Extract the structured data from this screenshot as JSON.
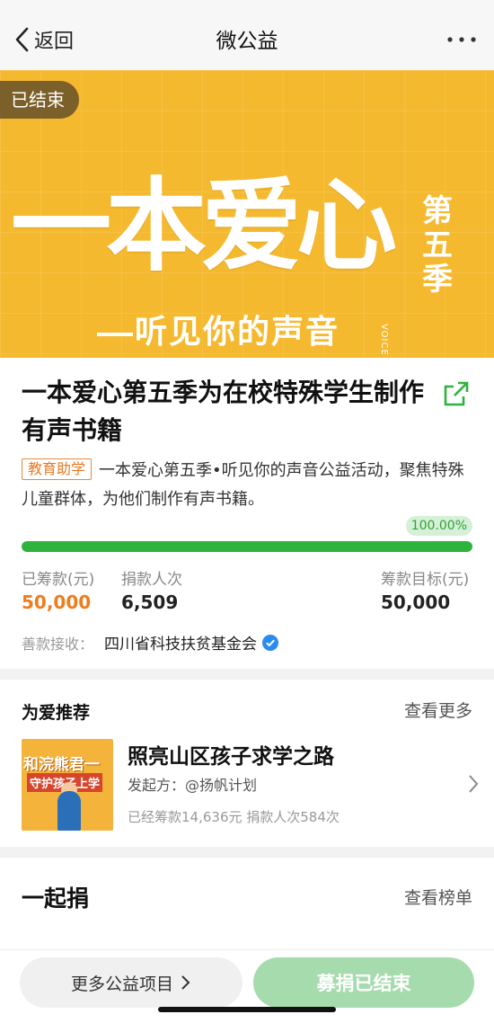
{
  "nav": {
    "back_label": "返回",
    "title": "微公益"
  },
  "banner": {
    "status": "已结束",
    "big_text": "一本爱心",
    "season": "第五季",
    "slogan": "听见你的声音",
    "voice": "VOICE"
  },
  "project": {
    "title": "一本爱心第五季为在校特殊学生制作有声书籍",
    "tag": "教育助学",
    "description": "一本爱心第五季•听见你的声音公益活动，聚焦特殊儿童群体，为他们制作有声书籍。",
    "progress_label": "100.00%",
    "progress": 1.0,
    "raised_label": "已筹款(元)",
    "raised_value": "50,000",
    "donors_label": "捐款人次",
    "donors_value": "6,509",
    "goal_label": "筹款目标(元)",
    "goal_value": "50,000",
    "receiver_label": "善款接收：",
    "receiver": "四川省科技扶贫基金会"
  },
  "recommend": {
    "heading": "为爱推荐",
    "more": "查看更多",
    "item": {
      "title": "照亮山区孩子求学之路",
      "initiator": "发起方：@扬帆计划",
      "stats": "已经筹款14,636元  捐款人次584次",
      "thumb_line1": "和浣熊君一",
      "thumb_line2": "守护孩子上学"
    }
  },
  "together": {
    "heading": "一起捐",
    "more": "查看榜单"
  },
  "bottom": {
    "more_projects": "更多公益项目",
    "status_button": "募捐已结束"
  },
  "colors": {
    "accent_green": "#2eb33d",
    "banner_yellow": "#f5b92f",
    "raised_orange": "#ee7d1c"
  }
}
